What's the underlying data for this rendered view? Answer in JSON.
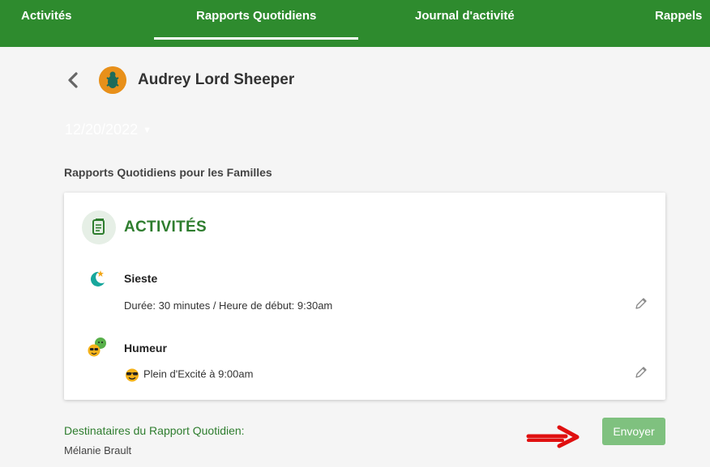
{
  "nav": {
    "tabs": [
      {
        "label": "Activités"
      },
      {
        "label": "Rapports Quotidiens",
        "active": true
      },
      {
        "label": "Journal d'activité"
      },
      {
        "label": "Rappels"
      }
    ]
  },
  "header": {
    "child_name": "Audrey Lord Sheeper",
    "date_value": "12/20/2022"
  },
  "section": {
    "title": "Rapports Quotidiens pour les Familles"
  },
  "card": {
    "heading": "ACTIVITÉS",
    "entries": [
      {
        "title": "Sieste",
        "description": "Durée: 30 minutes / Heure de début: 9:30am",
        "icon": "moon-star-icon"
      },
      {
        "title": "Humeur",
        "description": "Plein d'Excité à 9:00am",
        "icon": "mood-faces-icon",
        "mood_icon": "sunglasses-face-icon"
      }
    ]
  },
  "footer": {
    "recipients_label": "Destinataires du Rapport Quotidien:",
    "recipient_name": "Mélanie Brault",
    "send_label": "Envoyer"
  },
  "colors": {
    "nav_green": "#2e8b2e",
    "heading_green": "#2e7d2e",
    "send_button": "#7fc17f",
    "arrow_red": "#e01010"
  }
}
